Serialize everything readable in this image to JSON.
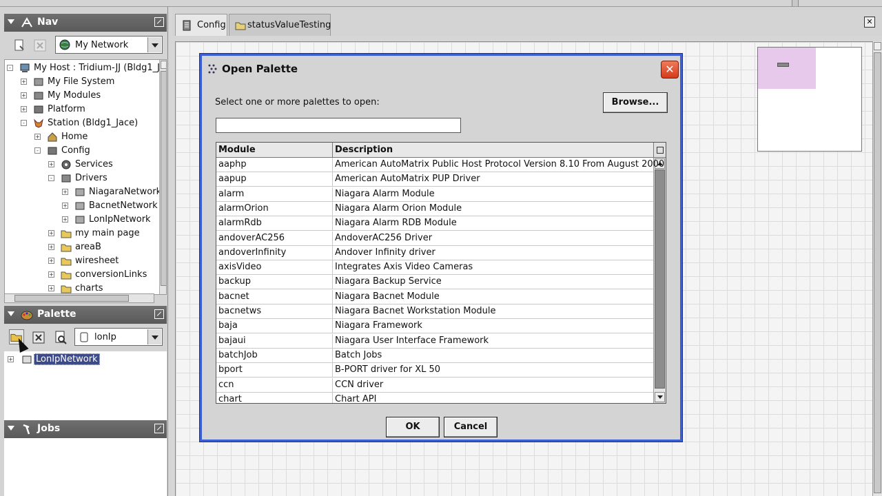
{
  "nav": {
    "title": "Nav",
    "network_combo": "My Network",
    "tree": [
      {
        "label": "My Host : Tridium-JJ (Bldg1_J",
        "icon": "computer-icon",
        "exp": "-"
      },
      {
        "label": "My File System",
        "icon": "drive-icon",
        "exp": "+"
      },
      {
        "label": "My Modules",
        "icon": "modules-icon",
        "exp": "+"
      },
      {
        "label": "Platform",
        "icon": "platform-icon",
        "exp": "+"
      },
      {
        "label": "Station (Bldg1_Jace)",
        "icon": "station-fox-icon",
        "exp": "-"
      },
      {
        "label": "Home",
        "icon": "home-icon",
        "exp": "+"
      },
      {
        "label": "Config",
        "icon": "config-icon",
        "exp": "-"
      },
      {
        "label": "Services",
        "icon": "services-gear-icon",
        "exp": "+"
      },
      {
        "label": "Drivers",
        "icon": "drivers-icon",
        "exp": "-"
      },
      {
        "label": "NiagaraNetwork",
        "icon": "network-icon",
        "exp": "+"
      },
      {
        "label": "BacnetNetwork",
        "icon": "network-icon",
        "exp": "+"
      },
      {
        "label": "LonIpNetwork",
        "icon": "network-icon",
        "exp": "+"
      },
      {
        "label": "my main page",
        "icon": "folder-icon",
        "exp": "+"
      },
      {
        "label": "areaB",
        "icon": "folder-icon",
        "exp": "+"
      },
      {
        "label": "wiresheet",
        "icon": "folder-icon",
        "exp": "+"
      },
      {
        "label": "conversionLinks",
        "icon": "folder-icon",
        "exp": "+"
      },
      {
        "label": "charts",
        "icon": "folder-icon",
        "exp": "+"
      }
    ]
  },
  "palette": {
    "title": "Palette",
    "combo": "lonIp",
    "tree_item": "LonIpNetwork"
  },
  "jobs": {
    "title": "Jobs"
  },
  "tabs": [
    {
      "label": "Config",
      "icon": "config-icon"
    },
    {
      "label": "statusValueTesting",
      "icon": "folder-icon"
    }
  ],
  "dialog": {
    "title": "Open Palette",
    "close_glyph": "✕",
    "prompt": "Select one or more palettes to open:",
    "browse_label": "Browse...",
    "search_value": "",
    "columns": [
      "Module",
      "Description"
    ],
    "rows": [
      {
        "module": "aaphp",
        "description": "American AutoMatrix Public Host Protocol Version 8.10 From August 2000"
      },
      {
        "module": "aapup",
        "description": "American AutoMatrix PUP Driver"
      },
      {
        "module": "alarm",
        "description": "Niagara Alarm Module"
      },
      {
        "module": "alarmOrion",
        "description": "Niagara Alarm Orion Module"
      },
      {
        "module": "alarmRdb",
        "description": "Niagara Alarm RDB Module"
      },
      {
        "module": "andoverAC256",
        "description": "AndoverAC256 Driver"
      },
      {
        "module": "andoverInfinity",
        "description": "Andover Infinity driver"
      },
      {
        "module": "axisVideo",
        "description": "Integrates Axis Video Cameras"
      },
      {
        "module": "backup",
        "description": "Niagara Backup Service"
      },
      {
        "module": "bacnet",
        "description": "Niagara Bacnet Module"
      },
      {
        "module": "bacnetws",
        "description": "Niagara Bacnet Workstation Module"
      },
      {
        "module": "baja",
        "description": "Niagara Framework"
      },
      {
        "module": "bajaui",
        "description": "Niagara User Interface Framework"
      },
      {
        "module": "batchJob",
        "description": "Batch Jobs"
      },
      {
        "module": "bport",
        "description": "B-PORT driver for XL 50"
      },
      {
        "module": "ccn",
        "description": "CCN driver"
      },
      {
        "module": "chart",
        "description": "Chart API"
      }
    ],
    "ok_label": "OK",
    "cancel_label": "Cancel"
  },
  "colors": {
    "header_bg": "#5f5f5f",
    "dialog_border": "#3d5fd6",
    "close_red": "#d33a1a",
    "overview_highlight": "#e7c9ec",
    "selection": "#3d4a8a"
  }
}
